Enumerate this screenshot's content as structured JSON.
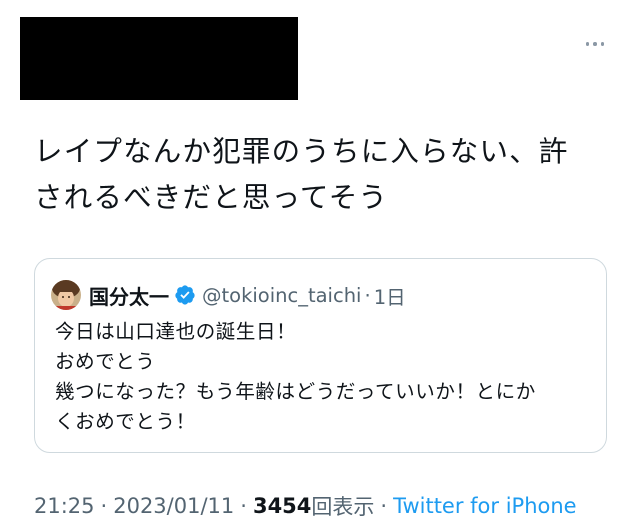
{
  "tweet": {
    "text_lines": [
      "レイプなんか犯罪のうちに入らない、許",
      "されるべきだと思ってそう"
    ]
  },
  "quoted_tweet": {
    "name": "国分太一",
    "handle": "@tokioinc_taichi",
    "separator": "·",
    "time": "1日",
    "verified": true,
    "lines": [
      "今日は山口達也の誕生日！",
      "おめでとう",
      "幾つになった？もう年齢はどうだっていいか！とにか",
      "くおめでとう！"
    ]
  },
  "meta": {
    "time": "21:25",
    "separator": "·",
    "date": "2023/01/11",
    "views_count": "3454",
    "views_label": "回表示",
    "source": "Twitter for iPhone"
  },
  "icons": {
    "more": "more-horizontal-icon",
    "verified": "verified-badge-icon"
  },
  "colors": {
    "link": "#1d9bf0",
    "secondary_text": "#536471",
    "border": "#cfd9de",
    "redaction": "#000000"
  }
}
